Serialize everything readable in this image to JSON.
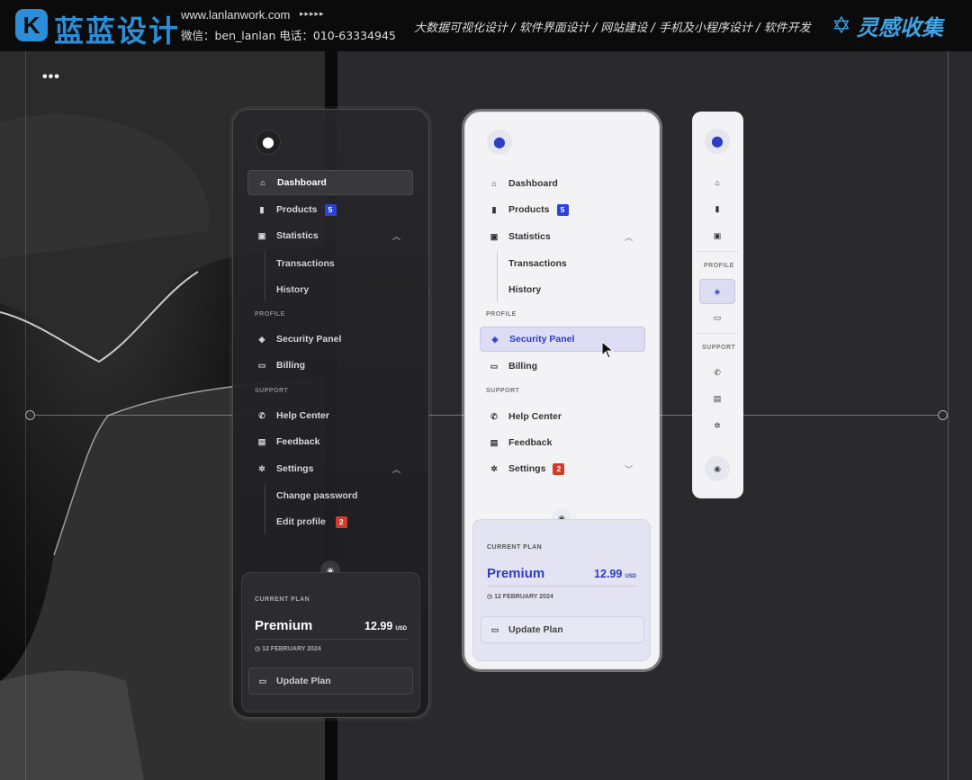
{
  "banner": {
    "logo_glyph": "K",
    "logo_text": "蓝蓝设计",
    "url": "www.lanlanwork.com",
    "arrows": "▸▸▸▸▸",
    "contact": "微信：ben_lanlan    电话：010-63334945",
    "services": "大数据可视化设计  /  软件界面设计  /  网站建设  /  手机及小程序设计  /  软件开发",
    "brand2_text": "灵感收集",
    "brand2_icon": "star-outline-icon"
  },
  "canvas": {
    "dots": "•••"
  },
  "dark_panel": {
    "items": [
      {
        "label": "Dashboard",
        "icon": "home-icon"
      },
      {
        "label": "Products",
        "icon": "bookmark-icon",
        "badge": "5"
      },
      {
        "label": "Statistics",
        "icon": "chart-icon"
      }
    ],
    "stats_sub": [
      "Transactions",
      "History"
    ],
    "profile_label": "PROFILE",
    "profile_items": [
      {
        "label": "Security Panel",
        "icon": "shield-icon"
      },
      {
        "label": "Billing",
        "icon": "card-icon"
      }
    ],
    "support_label": "SUPPORT",
    "support_items": [
      {
        "label": "Help Center",
        "icon": "phone-icon"
      },
      {
        "label": "Feedback",
        "icon": "document-icon"
      },
      {
        "label": "Settings",
        "icon": "gear-icon"
      }
    ],
    "settings_sub": [
      "Change password",
      "Edit profile"
    ],
    "settings_sub_badge": "2",
    "plan": {
      "label": "CURRENT PLAN",
      "name": "Premium",
      "price": "12.99",
      "currency": "USD",
      "date": "12 FEBRUARY 2024",
      "button": "Update Plan"
    }
  },
  "light_panel": {
    "items": [
      {
        "label": "Dashboard"
      },
      {
        "label": "Products",
        "badge": "5"
      },
      {
        "label": "Statistics"
      }
    ],
    "stats_sub": [
      "Transactions",
      "History"
    ],
    "profile_label": "PROFILE",
    "profile_items": [
      {
        "label": "Security Panel"
      },
      {
        "label": "Billing"
      }
    ],
    "support_label": "SUPPORT",
    "support_items": [
      {
        "label": "Help Center"
      },
      {
        "label": "Feedback"
      },
      {
        "label": "Settings",
        "badge": "2"
      }
    ],
    "plan": {
      "label": "CURRENT PLAN",
      "name": "Premium",
      "price": "12.99",
      "currency": "USD",
      "date": "12 FEBRUARY 2024",
      "button": "Update Plan"
    }
  },
  "mini_panel": {
    "profile_label": "PROFILE",
    "support_label": "SUPPORT"
  },
  "colors": {
    "accent": "#2b3ec4",
    "badge_blue": "#2f44d6",
    "badge_red": "#d23a2c",
    "brand": "#2a8fd8"
  }
}
